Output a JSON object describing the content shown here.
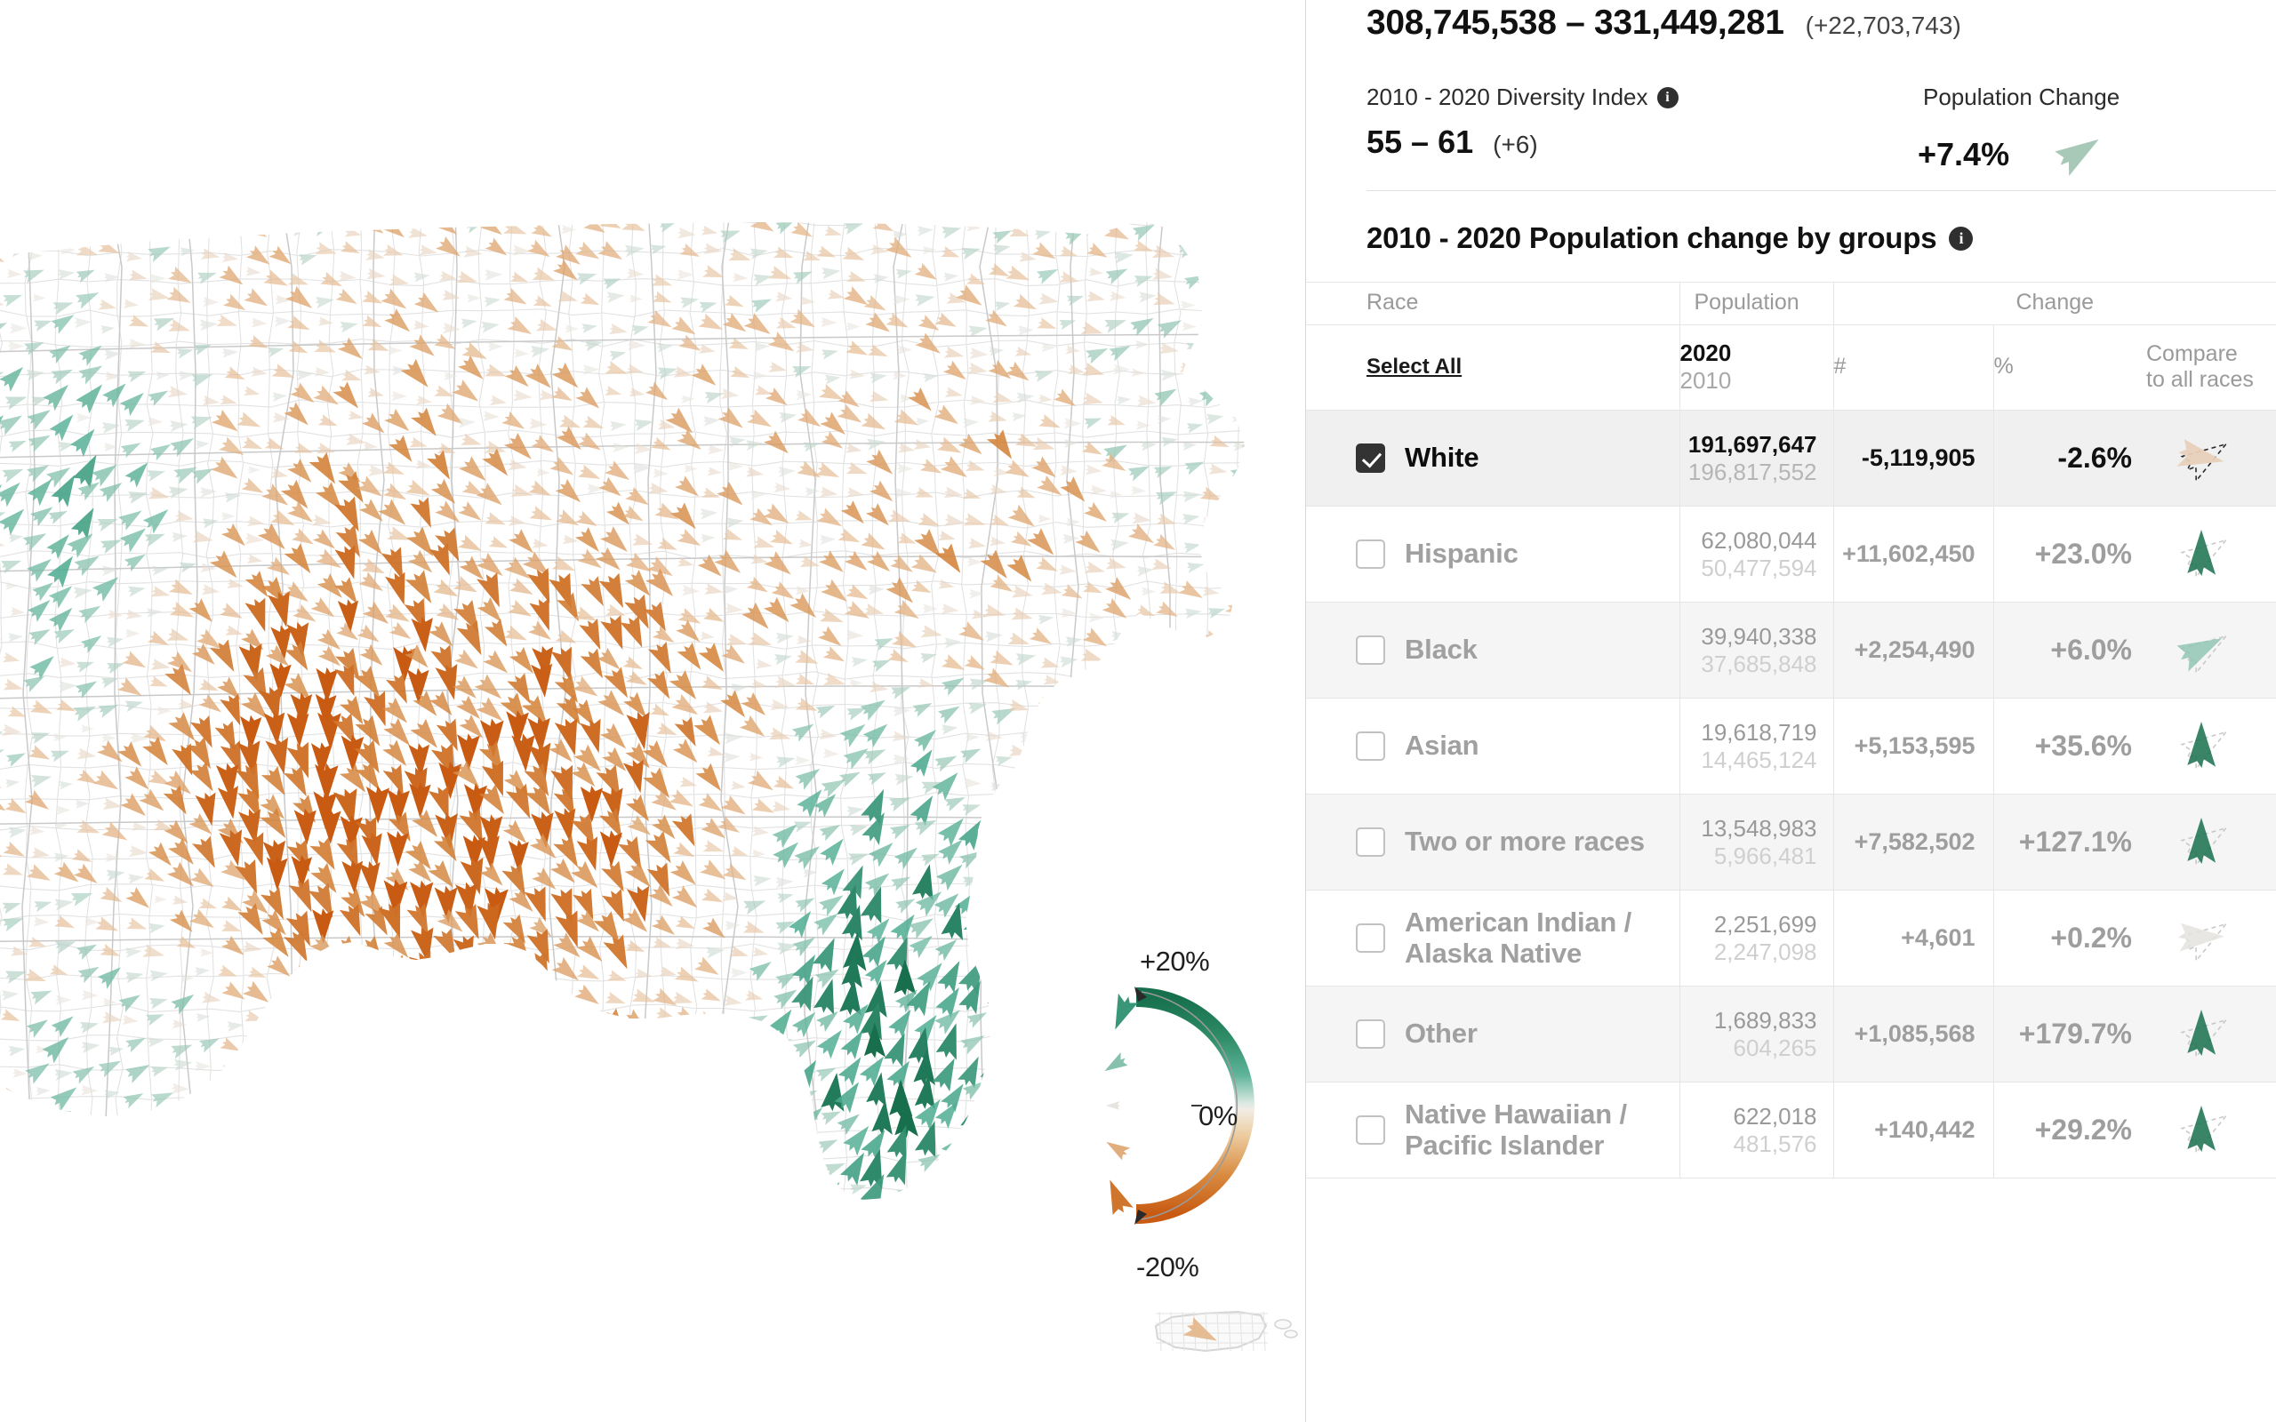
{
  "summary": {
    "population_range": "308,745,538 – 331,449,281",
    "population_delta": "(+22,703,743)",
    "diversity_label": "2010 - 2020 Diversity Index",
    "diversity_range": "55 – 61",
    "diversity_delta": "(+6)",
    "pop_change_label": "Population Change",
    "pop_change_value": "+7.4%",
    "info_glyph": "i"
  },
  "section": {
    "title": "2010 - 2020 Population change by groups",
    "info_glyph": "i"
  },
  "table": {
    "group_headers": {
      "race": "Race",
      "population": "Population",
      "change": "Change"
    },
    "sub_headers": {
      "select_all": "Select All",
      "year_2020": "2020",
      "year_2010": "2010",
      "hash": "#",
      "percent": "%",
      "compare_line1": "Compare",
      "compare_line2": "to all races"
    },
    "rows": [
      {
        "race": "White",
        "pop_2020": "191,697,647",
        "pop_2010": "196,817,552",
        "change_num": "-5,119,905",
        "change_pct": "-2.6%",
        "pct_value": -2.6,
        "checked": true
      },
      {
        "race": "Hispanic",
        "pop_2020": "62,080,044",
        "pop_2010": "50,477,594",
        "change_num": "+11,602,450",
        "change_pct": "+23.0%",
        "pct_value": 23.0,
        "checked": false
      },
      {
        "race": "Black",
        "pop_2020": "39,940,338",
        "pop_2010": "37,685,848",
        "change_num": "+2,254,490",
        "change_pct": "+6.0%",
        "pct_value": 6.0,
        "checked": false
      },
      {
        "race": "Asian",
        "pop_2020": "19,618,719",
        "pop_2010": "14,465,124",
        "change_num": "+5,153,595",
        "change_pct": "+35.6%",
        "pct_value": 35.6,
        "checked": false
      },
      {
        "race": "Two or more races",
        "pop_2020": "13,548,983",
        "pop_2010": "5,966,481",
        "change_num": "+7,582,502",
        "change_pct": "+127.1%",
        "pct_value": 127.1,
        "checked": false
      },
      {
        "race": "American Indian / Alaska Native",
        "pop_2020": "2,251,699",
        "pop_2010": "2,247,098",
        "change_num": "+4,601",
        "change_pct": "+0.2%",
        "pct_value": 0.2,
        "checked": false
      },
      {
        "race": "Other",
        "pop_2020": "1,689,833",
        "pop_2010": "604,265",
        "change_num": "+1,085,568",
        "change_pct": "+179.7%",
        "pct_value": 179.7,
        "checked": false
      },
      {
        "race": "Native Hawaiian / Pacific Islander",
        "pop_2020": "622,018",
        "pop_2010": "481,576",
        "change_num": "+140,442",
        "change_pct": "+29.2%",
        "pct_value": 29.2,
        "checked": false
      }
    ]
  },
  "legend": {
    "top_label": "+20%",
    "mid_label": "0%",
    "bottom_label": "-20%",
    "max_pct": 20,
    "min_pct": -20,
    "samples": [
      15,
      7,
      0,
      -7,
      -15
    ]
  },
  "colors": {
    "green_dark": "#176f4d",
    "green_mid": "#4fad92",
    "green_light": "#9cc9b8",
    "neutral": "#e8e4e0",
    "orange_light": "#e6bd95",
    "orange_mid": "#d4853c",
    "orange_dark": "#c85a12",
    "county_line": "#e2e2e2",
    "state_line": "#c9c9c9",
    "panel_bg": "#ffffff",
    "row_alt": "#f5f5f5",
    "checkbox_on": "#333333",
    "text_muted": "#9e9e9e"
  },
  "chart_data": {
    "type": "map",
    "title": "2010 - 2020 Population change by groups",
    "variable": "White population percent change by county, 2010-2020",
    "encoding": {
      "glyph": "dart-arrow",
      "angle": "percent change (up = positive, down = negative)",
      "color": "diverging green (positive) to orange (negative)",
      "size": "magnitude of change"
    },
    "scale_min": -20,
    "scale_max": 20,
    "scale_unit": "%",
    "legend_ticks": [
      "-20%",
      "0%",
      "+20%"
    ],
    "national_change_pct": 7.4,
    "selected_group": "White",
    "selected_group_change_pct": -2.6,
    "series": [
      {
        "name": "White",
        "values_2020": 191697647,
        "values_2010": 196817552,
        "change": -5119905,
        "pct": -2.6
      },
      {
        "name": "Hispanic",
        "values_2020": 62080044,
        "values_2010": 50477594,
        "change": 11602450,
        "pct": 23.0
      },
      {
        "name": "Black",
        "values_2020": 39940338,
        "values_2010": 37685848,
        "change": 2254490,
        "pct": 6.0
      },
      {
        "name": "Asian",
        "values_2020": 19618719,
        "values_2010": 14465124,
        "change": 5153595,
        "pct": 35.6
      },
      {
        "name": "Two or more races",
        "values_2020": 13548983,
        "values_2010": 5966481,
        "change": 7582502,
        "pct": 127.1
      },
      {
        "name": "American Indian / Alaska Native",
        "values_2020": 2251699,
        "values_2010": 2247098,
        "change": 4601,
        "pct": 0.2
      },
      {
        "name": "Other",
        "values_2020": 1689833,
        "values_2010": 604265,
        "change": 1085568,
        "pct": 179.7
      },
      {
        "name": "Native Hawaiian / Pacific Islander",
        "values_2020": 622018,
        "values_2010": 481576,
        "change": 140442,
        "pct": 29.2
      }
    ],
    "total_population_2010": 308745538,
    "total_population_2020": 331449281,
    "total_change": 22703743,
    "diversity_index_2010": 55,
    "diversity_index_2020": 61,
    "diversity_index_change": 6
  }
}
